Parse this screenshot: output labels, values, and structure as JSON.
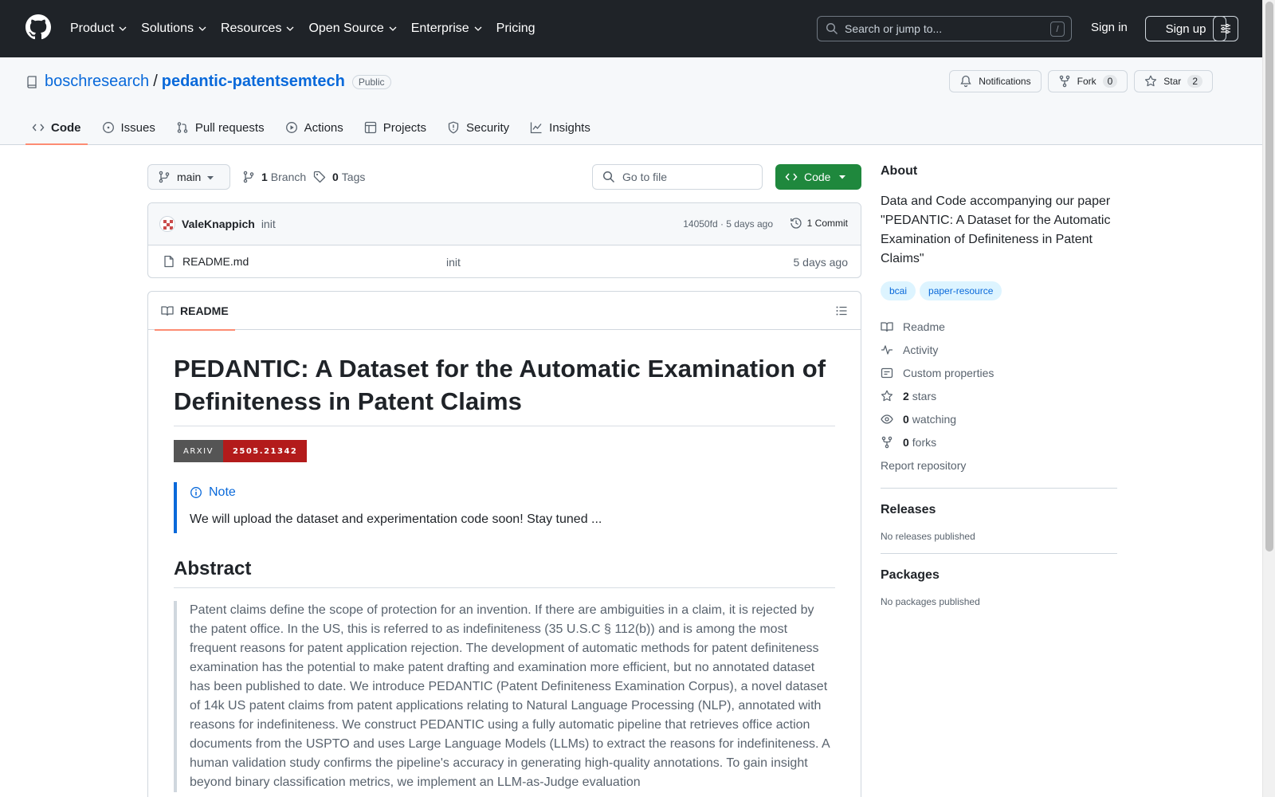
{
  "header": {
    "nav": [
      "Product",
      "Solutions",
      "Resources",
      "Open Source",
      "Enterprise",
      "Pricing"
    ],
    "search_placeholder": "Search or jump to...",
    "search_key": "/",
    "signin": "Sign in",
    "signup": "Sign up"
  },
  "repo": {
    "owner": "boschresearch",
    "separator": "/",
    "name": "pedantic-patentsemtech",
    "visibility": "Public",
    "notifications_label": "Notifications",
    "fork_label": "Fork",
    "fork_count": "0",
    "star_label": "Star",
    "star_count": "2"
  },
  "tabs": [
    "Code",
    "Issues",
    "Pull requests",
    "Actions",
    "Projects",
    "Security",
    "Insights"
  ],
  "branchbar": {
    "branch": "main",
    "branches_count": "1",
    "branches_label": "Branch",
    "tags_count": "0",
    "tags_label": "Tags",
    "goto_placeholder": "Go to file",
    "code_button": "Code"
  },
  "commit": {
    "author": "ValeKnappich",
    "message": "init",
    "meta": "14050fd · 5 days ago",
    "count_label": "1 Commit"
  },
  "files": [
    {
      "name": "README.md",
      "message": "init",
      "time": "5 days ago"
    }
  ],
  "readme": {
    "tab_label": "README",
    "title": "PEDANTIC: A Dataset for the Automatic Examination of Definiteness in Patent Claims",
    "badge_left": "ARXIV",
    "badge_right": "2505.21342",
    "note_title": "Note",
    "note_text": "We will upload the dataset and experimentation code soon! Stay tuned ...",
    "abstract_heading": "Abstract",
    "abstract_text": "Patent claims define the scope of protection for an invention. If there are ambiguities in a claim, it is rejected by the patent office. In the US, this is referred to as indefiniteness (35 U.S.C § 112(b)) and is among the most frequent reasons for patent application rejection. The development of automatic methods for patent definiteness examination has the potential to make patent drafting and examination more efficient, but no annotated dataset has been published to date. We introduce PEDANTIC (Patent Definiteness Examination Corpus), a novel dataset of 14k US patent claims from patent applications relating to Natural Language Processing (NLP), annotated with reasons for indefiniteness. We construct PEDANTIC using a fully automatic pipeline that retrieves office action documents from the USPTO and uses Large Language Models (LLMs) to extract the reasons for indefiniteness. A human validation study confirms the pipeline's accuracy in generating high-quality annotations. To gain insight beyond binary classification metrics, we implement an LLM-as-Judge evaluation"
  },
  "sidebar": {
    "about_heading": "About",
    "about_text": "Data and Code accompanying our paper \"PEDANTIC: A Dataset for the Automatic Examination of Definiteness in Patent Claims\"",
    "topics": [
      "bcai",
      "paper-resource"
    ],
    "readme": "Readme",
    "activity": "Activity",
    "custom_properties": "Custom properties",
    "stars_count": "2",
    "stars_label": "stars",
    "watching_count": "0",
    "watching_label": "watching",
    "forks_count": "0",
    "forks_label": "forks",
    "report": "Report repository",
    "releases_heading": "Releases",
    "releases_text": "No releases published",
    "packages_heading": "Packages",
    "packages_text": "No packages published"
  },
  "colors": {
    "header_bg": "#1f2328",
    "link": "#0969da",
    "primary_button": "#1f883d",
    "tab_underline": "#fd8c73",
    "arxiv_red": "#b31b1b"
  }
}
